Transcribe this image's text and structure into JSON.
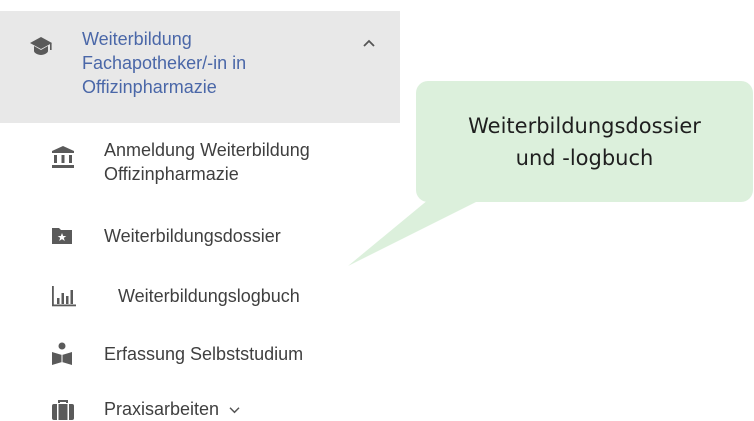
{
  "menu": {
    "section": {
      "icon": "graduation-cap-icon",
      "label_lines": [
        "Weiterbildung",
        "Fachapotheker/-in in",
        "Offizinpharmazie"
      ],
      "expanded_icon": "chevron-up-icon"
    },
    "items": [
      {
        "icon": "institution-icon",
        "label_lines": [
          "Anmeldung Weiterbildung",
          "Offizinpharmazie"
        ]
      },
      {
        "icon": "folder-star-icon",
        "label_lines": [
          "Weiterbildungsdossier"
        ]
      },
      {
        "icon": "bar-chart-icon",
        "label_lines": [
          "Weiterbildungslogbuch"
        ]
      },
      {
        "icon": "reading-person-icon",
        "label_lines": [
          "Erfassung Selbststudium"
        ]
      },
      {
        "icon": "briefcase-icon",
        "label_lines": [
          "Praxisarbeiten"
        ],
        "dropdown_icon": "chevron-down-icon"
      }
    ]
  },
  "callout": {
    "lines": [
      "Weiterbildungsdossier",
      "und -logbuch"
    ]
  },
  "colors": {
    "header_bg": "#e8e8e8",
    "header_text": "#4a67a8",
    "item_text": "#3f3f3f",
    "icon": "#5a5a5a",
    "callout_bg": "#dcf0dc"
  }
}
